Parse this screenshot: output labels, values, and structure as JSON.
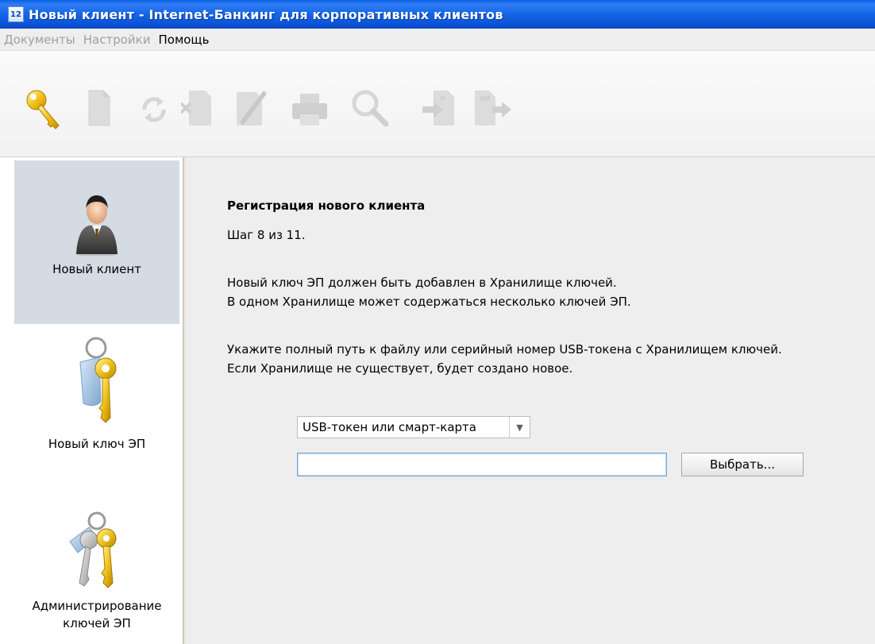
{
  "window": {
    "icon_text": "12",
    "title": "Новый клиент - Internet-Банкинг для корпоративных клиентов"
  },
  "menu": {
    "items": [
      {
        "label": "Документы",
        "enabled": false
      },
      {
        "label": "Настройки",
        "enabled": false
      },
      {
        "label": "Помощь",
        "enabled": true
      }
    ]
  },
  "toolbar": {
    "icons": [
      "key-icon",
      "new-document-icon",
      "refresh-icon",
      "delete-icon",
      "edit-icon",
      "print-icon",
      "search-icon",
      "import-icon",
      "export-icon"
    ],
    "import_label": "in",
    "export_label": "out"
  },
  "sidebar": {
    "items": [
      {
        "label": "Новый клиент",
        "icon": "user-icon",
        "active": true
      },
      {
        "label": "Новый ключ ЭП",
        "icon": "key-tag-icon",
        "active": false
      },
      {
        "label": "Администрирование ключей ЭП",
        "label_line1": "Администрирование",
        "label_line2": "ключей ЭП",
        "icon": "keys-bunch-icon",
        "active": false
      }
    ]
  },
  "wizard": {
    "heading": "Регистрация нового клиента",
    "step": "Шаг 8 из 11.",
    "para1_line1": "Новый ключ ЭП должен быть добавлен в Хранилище ключей.",
    "para1_line2": "В одном Хранилище может содержаться несколько ключей ЭП.",
    "para2_line1": "Укажите полный путь к файлу или серийный номер USB-токена с Хранилищем ключей.",
    "para2_line2": "Если Хранилище не существует, будет создано новое.",
    "storage_type": "USB-токен или смарт-карта",
    "path_value": "",
    "browse_label": "Выбрать..."
  },
  "colors": {
    "titlebar": "#1565e6",
    "active_nav": "#d5dbe3",
    "content_bg": "#eeeeee"
  }
}
